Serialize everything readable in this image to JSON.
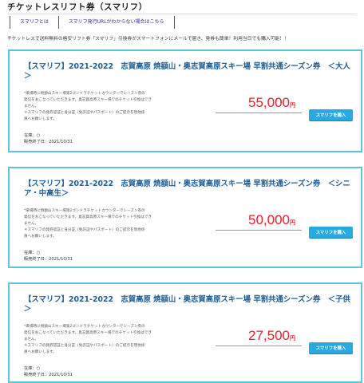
{
  "page_title": "チケットレスリフト券（スマリフ）",
  "nav": [
    {
      "label": "スマリフとは"
    },
    {
      "label": "スマリフ発行URLがわからない場合はこちら"
    }
  ],
  "intro_text": "チケットレスで送料無料の格安リフト券「スマリフ」引換券がスマートフォンにメールで届き、発券も簡単！利用当日でも購入可能！！",
  "colors": {
    "card_border": "#5ec3dc",
    "title_text": "#1e5f96",
    "price_text": "#e8202a",
    "button_bg": "#27a9e1"
  },
  "products": [
    {
      "title": "【スマリフ】2021-2022　志賀高原 焼額山・奥志賀高原スキー場 早割共通シーズン券　＜大人＞",
      "desc_1": "*来場時に焼額山スキー場第2ゴンドラチケットカウンターでシーズン券の",
      "desc_2": "発信をおこなっていただきます。奥志賀高原スキー場でのチケット引換はでき",
      "desc_3": "ません。",
      "desc_4": "＊スマリフの発券認証と身分証（免許証やパスポート）のご提示を現地係",
      "desc_5": "員へお願いします。",
      "stock": "在庫：○",
      "sale_end": "販売終了日：2021/10/31",
      "price": "55,000",
      "price_unit": "円",
      "button_label": "スマリフを購入"
    },
    {
      "title": "【スマリフ】2021-2022　志賀高原 焼額山・奥志賀高原スキー場 早割共通シーズン券　＜シニア・中高生＞",
      "desc_1": "*来場時に焼額山スキー場第2ゴンドラチケットカウンターでシーズン券の",
      "desc_2": "発信をおこなっていただきます。奥志賀高原スキー場でのチケット引換はでき",
      "desc_3": "ません。",
      "desc_4": "＊スマリフの発券認証と身分証（免許証やパスポート）のご提示を現地係",
      "desc_5": "員へお願いします。",
      "stock": "在庫：○",
      "sale_end": "販売終了日：2021/10/31",
      "price": "50,000",
      "price_unit": "円",
      "button_label": "スマリフを購入"
    },
    {
      "title": "【スマリフ】2021-2022　志賀高原 焼額山・奥志賀高原スキー場 早割共通シーズン券　＜子供＞",
      "desc_1": "*来場時に焼額山スキー場第2ゴンドラチケットカウンターでシーズン券の",
      "desc_2": "発信をおこなっていただきます。奥志賀高原スキー場でのチケット引換はでき",
      "desc_3": "ません。",
      "desc_4": "＊スマリフの発券認証と身分証（免許証やパスポート）のご提示を現地係",
      "desc_5": "員へお願いします。",
      "stock": "在庫：○",
      "sale_end": "販売終了日：2021/10/31",
      "price": "27,500",
      "price_unit": "円",
      "button_label": "スマリフを購入"
    }
  ]
}
